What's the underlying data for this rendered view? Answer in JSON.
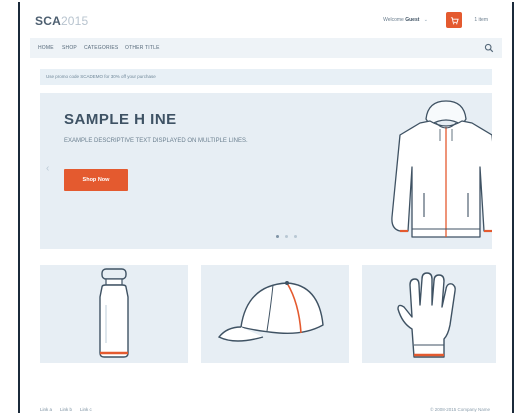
{
  "brand": {
    "logo_bold": "SCA",
    "logo_light": "2015"
  },
  "header": {
    "welcome_prefix": "Welcome",
    "welcome_user": "Guest",
    "caret": "⌄",
    "cart_count": "1 item"
  },
  "nav": {
    "items": [
      "HOME",
      "SHOP",
      "CATEGORIES",
      "OTHER TITLE"
    ]
  },
  "promo": {
    "text": "Use promo code SCADEMO for 30% off your purchase"
  },
  "hero": {
    "title": "SAMPLE H INE",
    "description": "EXAMPLE DESCRIPTIVE TEXT DISPLAYED ON MULTIPLE LINES.",
    "button_label": "Shop Now",
    "prev_arrow": "‹",
    "next_arrow": "›",
    "slide_count": 3,
    "active_slide": 1
  },
  "tiles": [
    {
      "name": "bottle"
    },
    {
      "name": "cap"
    },
    {
      "name": "glove"
    }
  ],
  "footer": {
    "links": [
      "Link a",
      "Link b",
      "Link c"
    ],
    "copyright": "© 2008-2015 Company Name"
  },
  "colors": {
    "accent": "#e45a2f",
    "panel": "#e7eef4",
    "nav_bg": "#eef3f7",
    "text": "#3e5264"
  }
}
